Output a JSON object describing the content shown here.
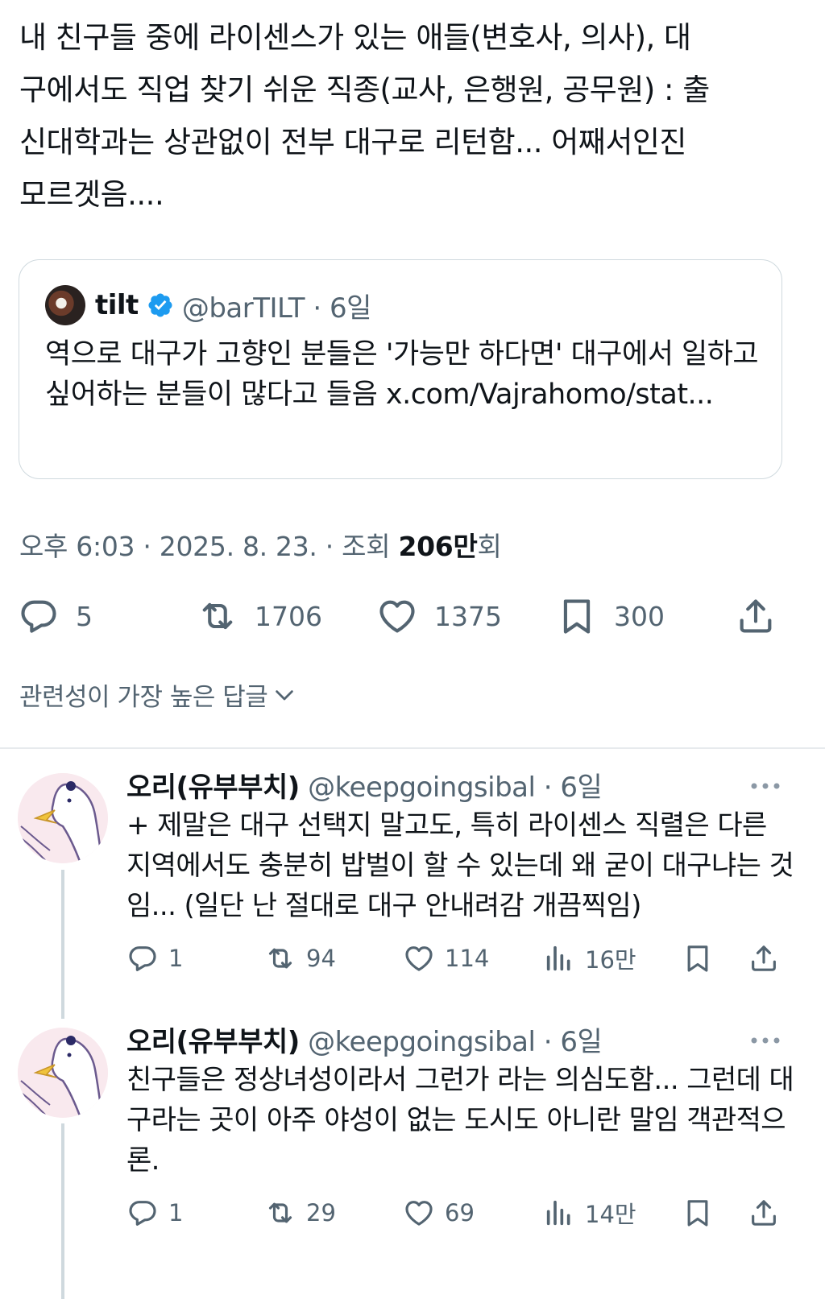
{
  "tweet": {
    "text": "내 친구들 중에 라이센스가 있는 애들(변호사, 의사), 대\n구에서도 직업 찾기 쉬운 직종(교사, 은행원, 공무원) : 출\n신대학과는 상관없이 전부 대구로 리턴함... 어째서인진\n모르겟음....",
    "quote": {
      "name": "tilt",
      "handle_time": "@barTILT · 6일",
      "text": "역으로 대구가 고향인 분들은 '가능만 하다면' 대구에서 일하고 싶어하는 분들이 많다고 들음 x.com/Vajrahomo/stat..."
    },
    "meta": {
      "datetime": "오후 6:03 · 2025. 8. 23. · 조회 ",
      "views_number": "206",
      "views_unit": "만",
      "views_suffix": "회"
    },
    "actions": {
      "replies": "5",
      "retweets": "1706",
      "likes": "1375",
      "bookmarks": "300"
    }
  },
  "sort_label": "관련성이 가장 높은 답글",
  "replies": [
    {
      "name": "오리(유부부치)",
      "handle_time": "@keepgoingsibal · 6일",
      "text": "+ 제말은 대구 선택지 말고도, 특히 라이센스 직렬은 다른 지역에서도 충분히 밥벌이 할 수 있는데 왜 굳이 대구냐는 것임... (일단 난 절대로 대구 안내려감 개끔찍임)",
      "replies": "1",
      "retweets": "94",
      "likes": "114",
      "views": "16만"
    },
    {
      "name": "오리(유부부치)",
      "handle_time": "@keepgoingsibal · 6일",
      "text": "친구들은 정상녀성이라서 그런가 라는 의심도함... 그런데 대구라는 곳이 아주 야성이 없는 도시도 아니란 말임 객관적으론.",
      "replies": "1",
      "retweets": "29",
      "likes": "69",
      "views": "14만"
    }
  ],
  "colors": {
    "text": "#0f1419",
    "secondary": "#536471",
    "border": "#cfd9de",
    "verified": "#1d9bf0"
  }
}
